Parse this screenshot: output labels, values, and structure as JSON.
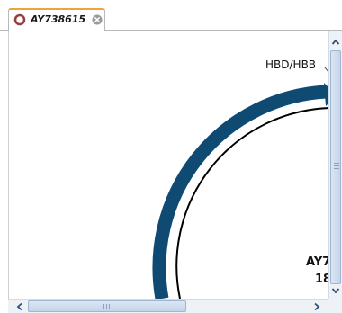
{
  "tab": {
    "title": "AY738615",
    "icon": "circular-sequence-icon",
    "close_icon": "close-tab-icon",
    "accent_color": "#f0a33a"
  },
  "canvas": {
    "feature_label": "HBD/HBB",
    "sequence_name": "AY7",
    "sequence_length": "18",
    "feature_color": "#0f4a73",
    "backbone_color": "#000000"
  },
  "scrollbars": {
    "vertical": {
      "up_icon": "arrow-up-icon",
      "down_icon": "arrow-down-icon"
    },
    "horizontal": {
      "left_icon": "arrow-left-icon",
      "right_icon": "arrow-right-icon"
    }
  }
}
